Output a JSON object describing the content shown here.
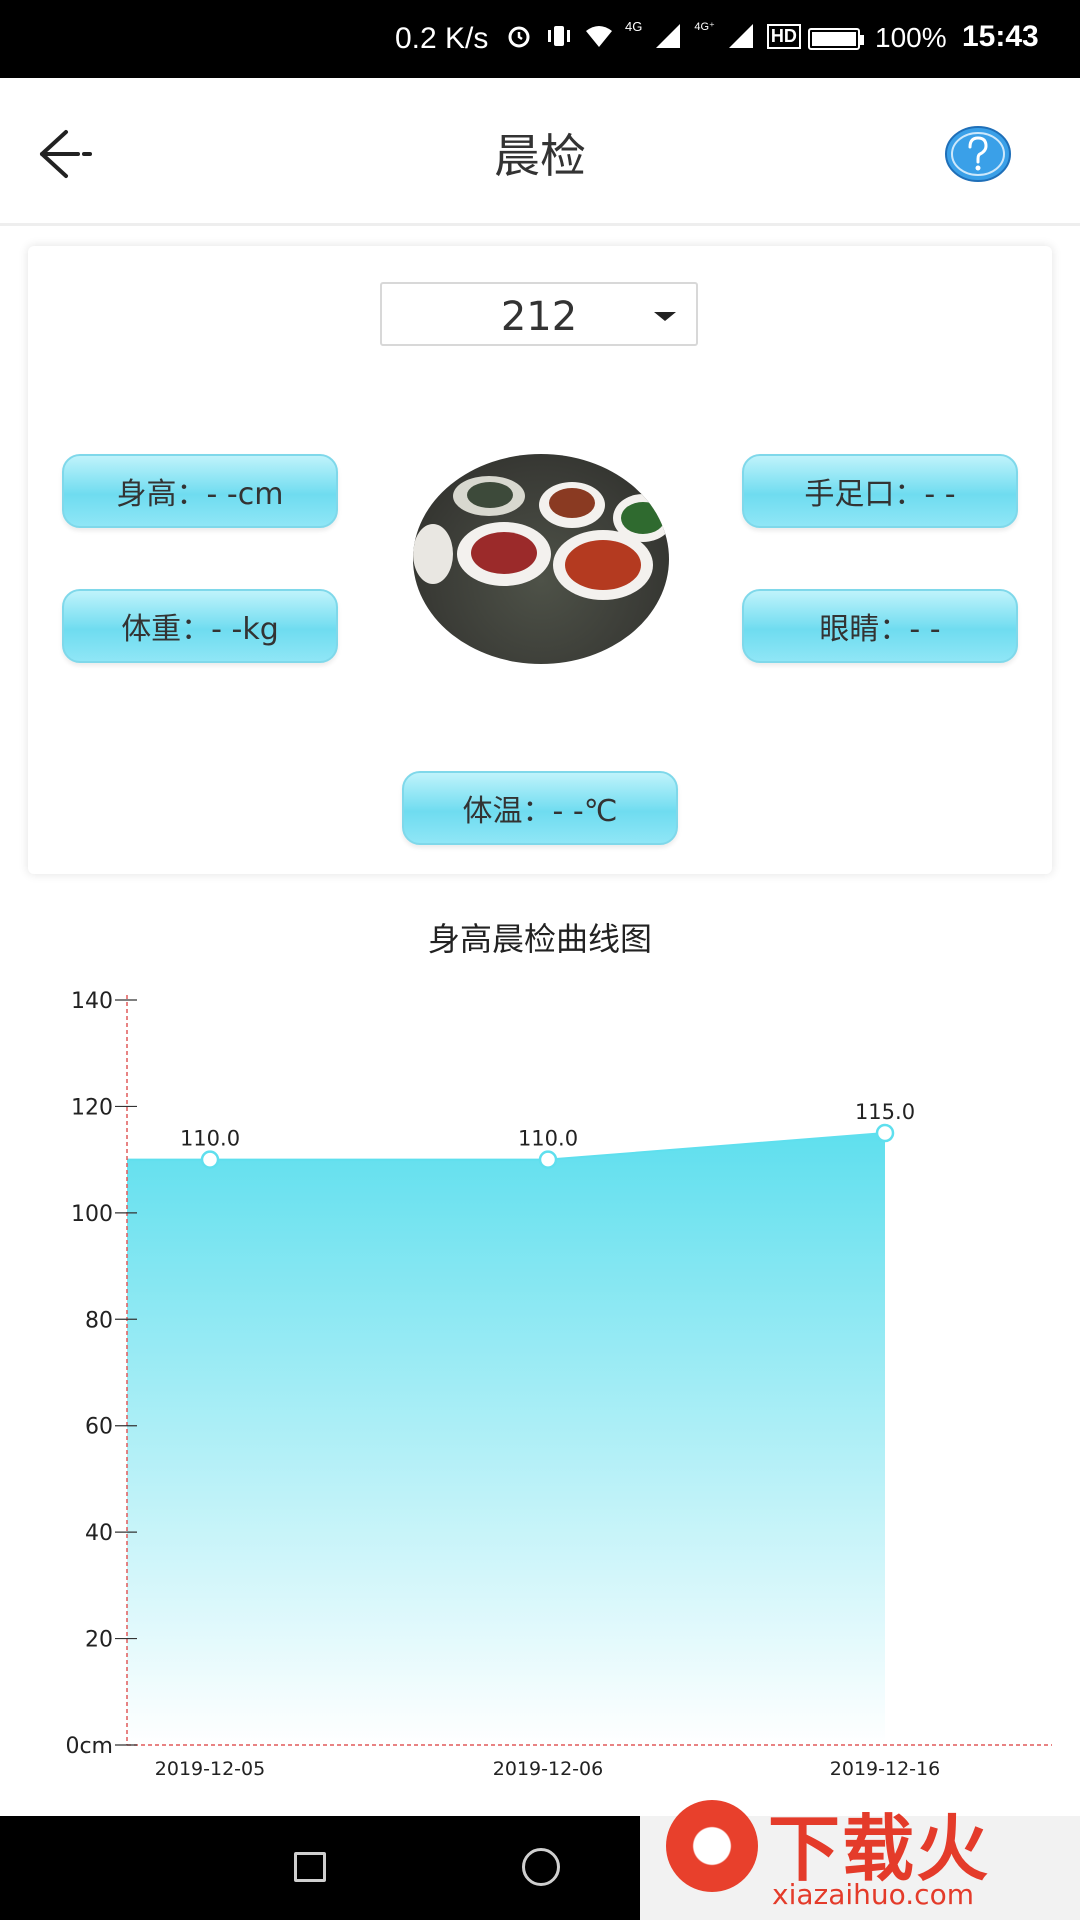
{
  "status_bar": {
    "speed": "0.2 K/s",
    "network_4g_1": "4G",
    "network_4g_2": "4G⁺",
    "hd": "HD",
    "battery": "100%",
    "time": "15:43"
  },
  "header": {
    "back_icon": "back-arrow-icon",
    "title": "晨检",
    "help_icon": "question-circle-icon"
  },
  "selector": {
    "value": "212"
  },
  "metrics": {
    "height": "身高：- -cm",
    "weight": "体重：- -kg",
    "hand_foot_mouth": "手足口：- -",
    "eyes": "眼睛：- -",
    "temperature": "体温：- -℃"
  },
  "chart_data": {
    "type": "area",
    "title": "身高晨检曲线图",
    "categories": [
      "2019-12-05",
      "2019-12-06",
      "2019-12-16"
    ],
    "values": [
      110.0,
      110.0,
      115.0
    ],
    "data_labels": [
      "110.0",
      "110.0",
      "115.0"
    ],
    "y_ticks": [
      "0cm",
      "20",
      "40",
      "60",
      "80",
      "100",
      "120",
      "140"
    ],
    "ylim": [
      0,
      140
    ],
    "colors": {
      "fill_top": "#5fdfee",
      "fill_bottom": "#ffffff",
      "line": "#5fdfee",
      "axis": "#e05a5a"
    }
  },
  "watermark": {
    "text": "下载火",
    "url": "xiazaihuo.com"
  }
}
